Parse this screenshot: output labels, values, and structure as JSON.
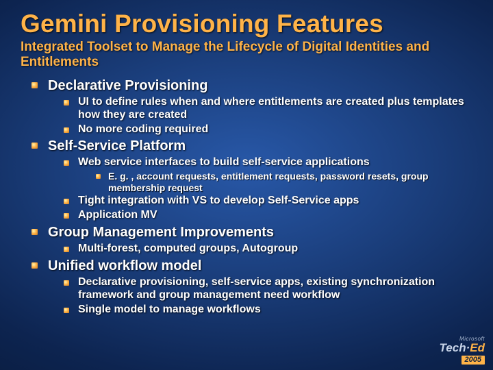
{
  "title": "Gemini Provisioning Features",
  "subtitle": "Integrated Toolset to Manage the Lifecycle of Digital Identities and Entitlements",
  "s1": {
    "h": "Declarative Provisioning",
    "a": "UI to define rules when and where entitlements are created plus templates how they are created",
    "b": "No more coding required"
  },
  "s2": {
    "h": "Self-Service Platform",
    "a": "Web service interfaces to build self-service applications",
    "a1": "E. g. , account requests, entitlement requests, password resets, group membership request",
    "b": "Tight integration with VS to develop Self-Service apps",
    "c": "Application MV"
  },
  "s3": {
    "h": "Group Management Improvements",
    "a": "Multi-forest, computed groups, Autogroup"
  },
  "s4": {
    "h": "Unified workflow model",
    "a": "Declarative provisioning, self-service apps, existing synchronization framework and group management need workflow",
    "b": "Single model to manage workflows"
  },
  "logo": {
    "ms": "Microsoft",
    "brand1": "Tech·",
    "brand2": "Ed",
    "year": "2005"
  }
}
